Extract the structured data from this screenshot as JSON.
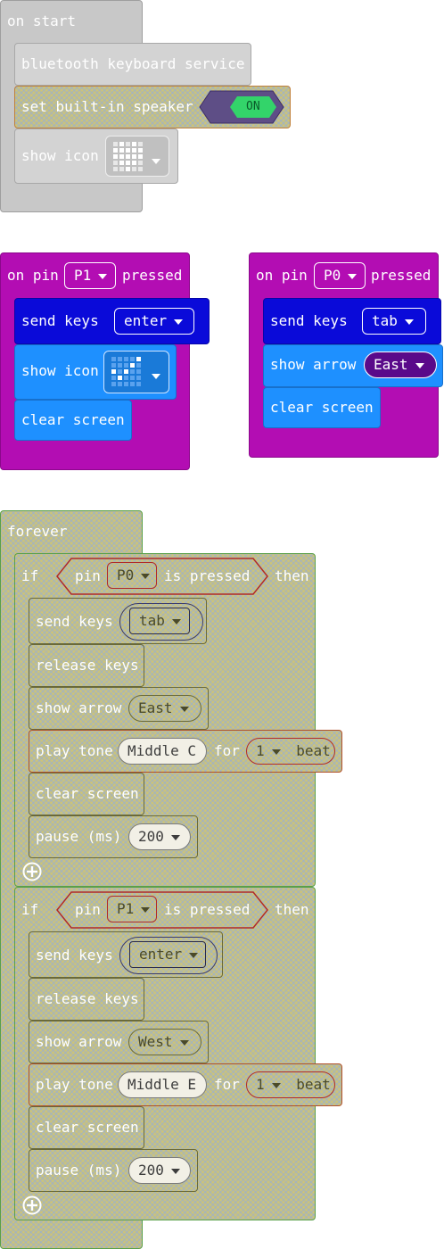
{
  "on_start": {
    "title": "on start",
    "b1": "bluetooth keyboard service",
    "b2": "set built-in speaker",
    "toggle": "ON",
    "b3": "show icon"
  },
  "pin_p1": {
    "prefix": "on pin",
    "pin": "P1",
    "suffix": "pressed",
    "send_keys": "send keys",
    "key": "enter",
    "show_icon": "show icon",
    "clear": "clear screen"
  },
  "pin_p0": {
    "prefix": "on pin",
    "pin": "P0",
    "suffix": "pressed",
    "send_keys": "send keys",
    "key": "tab",
    "show_arrow": "show arrow",
    "arrow": "East",
    "clear": "clear screen"
  },
  "forever": {
    "title": "forever",
    "if1": {
      "if": "if",
      "pin": "pin",
      "pin_name": "P0",
      "is_pressed": "is pressed",
      "then": "then",
      "send_keys": "send keys",
      "key": "tab",
      "release": "release keys",
      "show_arrow": "show arrow",
      "arrow": "East",
      "play_tone": "play tone",
      "note": "Middle C",
      "for": "for",
      "beats": "1",
      "beat": "beat",
      "clear": "clear screen",
      "pause": "pause (ms)",
      "ms": "200"
    },
    "if2": {
      "if": "if",
      "pin": "pin",
      "pin_name": "P1",
      "is_pressed": "is pressed",
      "then": "then",
      "send_keys": "send keys",
      "key": "enter",
      "release": "release keys",
      "show_arrow": "show arrow",
      "arrow": "West",
      "play_tone": "play tone",
      "note": "Middle E",
      "for": "for",
      "beats": "1",
      "beat": "beat",
      "clear": "clear screen",
      "pause": "pause (ms)",
      "ms": "200"
    }
  },
  "colors": {
    "grey": "#c8c8c8",
    "magenta": "#b30db3",
    "navy": "#0a0ad9",
    "sky": "#1e90ff",
    "disabled": "#c9c27e"
  }
}
